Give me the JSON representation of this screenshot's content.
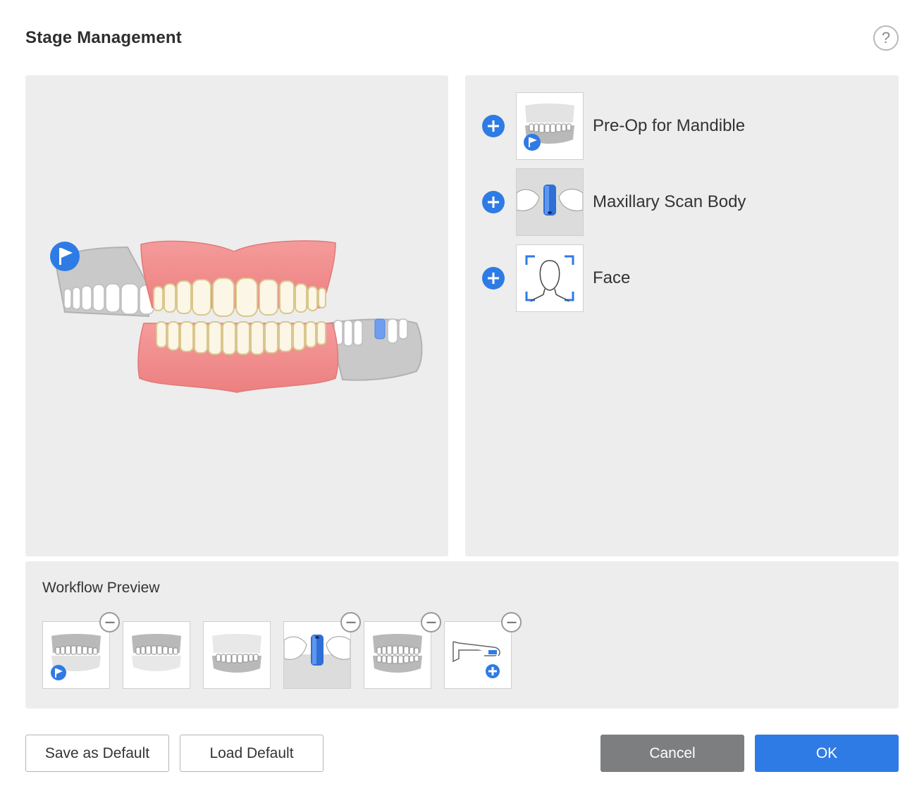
{
  "dialog": {
    "title": "Stage Management",
    "help_label": "?"
  },
  "available_stages": [
    {
      "label": "Pre-Op for Mandible",
      "icon": "pre-op-mandible-icon"
    },
    {
      "label": "Maxillary Scan Body",
      "icon": "scan-body-icon"
    },
    {
      "label": "Face",
      "icon": "face-scan-icon"
    }
  ],
  "workflow_preview": {
    "title": "Workflow Preview",
    "steps": [
      {
        "icon": "pre-op-upper-jaw-icon",
        "removable": true
      },
      {
        "icon": "upper-jaw-icon",
        "removable": false
      },
      {
        "icon": "lower-jaw-icon",
        "removable": false
      },
      {
        "icon": "scan-body-icon",
        "removable": true
      },
      {
        "icon": "occlusion-icon",
        "removable": true
      },
      {
        "icon": "intraoral-scanner-tip-icon",
        "removable": true
      }
    ]
  },
  "footer": {
    "save_default_label": "Save as Default",
    "load_default_label": "Load Default",
    "cancel_label": "Cancel",
    "ok_label": "OK"
  },
  "colors": {
    "accent": "#2f7be5",
    "gum": "#f08f8f",
    "tooth": "#fbf6e6",
    "panel": "#ededed"
  }
}
